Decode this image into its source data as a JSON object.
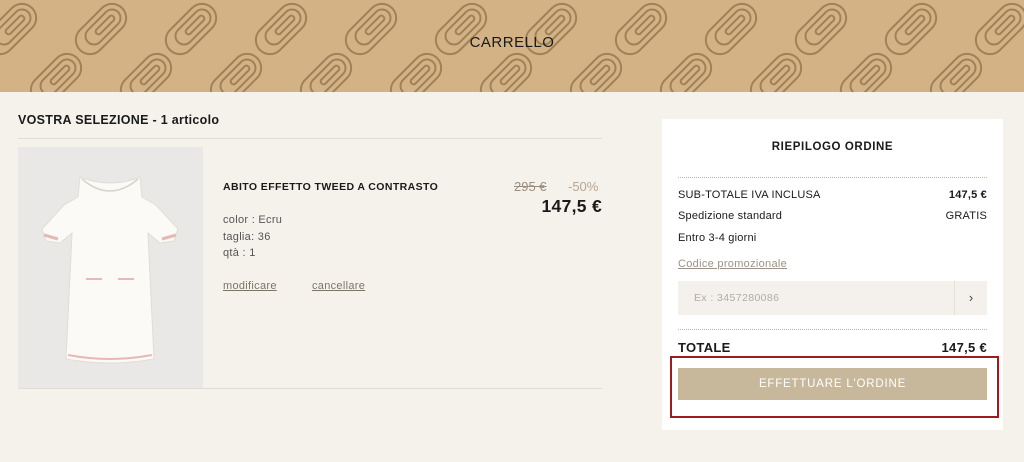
{
  "header": {
    "title": "CARRELLO"
  },
  "selection": {
    "title": "VOSTRA SELEZIONE - 1 articolo",
    "item": {
      "name": "ABITO EFFETTO TWEED A CONTRASTO",
      "price_old": "295 €",
      "discount": "-50%",
      "price_new": "147,5 €",
      "color": "color : Ecru",
      "size": "taglia: 36",
      "quantity": "qtà : 1",
      "modify_label": "modificare",
      "delete_label": "cancellare"
    }
  },
  "summary": {
    "title": "RIEPILOGO ORDINE",
    "subtotal_label": "SUB-TOTALE IVA INCLUSA",
    "subtotal_value": "147,5 €",
    "shipping_label": "Spedizione standard",
    "shipping_value": "GRATIS",
    "delivery_time": "Entro 3-4 giorni",
    "promo_link": "Codice promozionale",
    "promo_placeholder": "Ex : 3457280086",
    "promo_submit": "›",
    "total_label": "TOTALE",
    "total_value": "147,5 €",
    "order_button": "EFFETTUARE L'ORDINE"
  },
  "colors": {
    "banner": "#d3b385",
    "background": "#f5f2ec",
    "order_button": "#c8b89b",
    "highlight_frame": "#9b1c1c"
  }
}
